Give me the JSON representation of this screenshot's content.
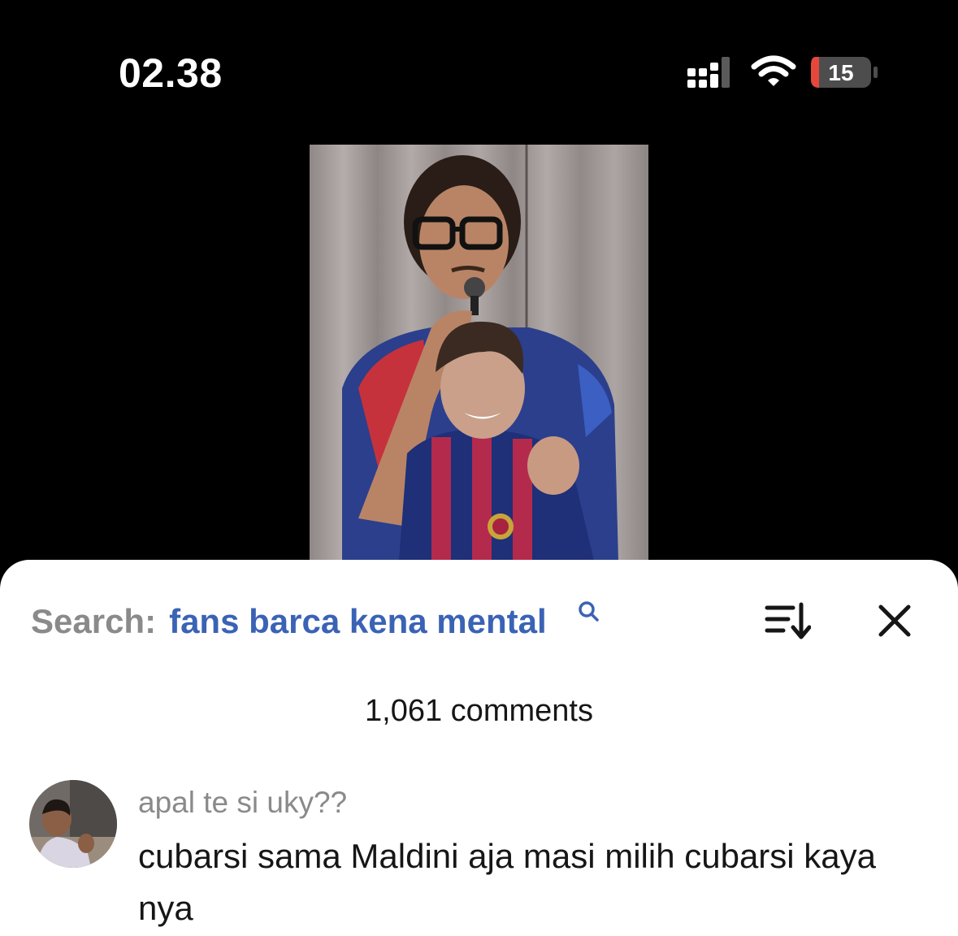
{
  "status_bar": {
    "time": "02.38",
    "battery_level": "15",
    "icons": [
      "signal-icon",
      "wifi-icon",
      "battery-icon"
    ]
  },
  "video": {
    "thumbnail": "video-thumbnail"
  },
  "comment_sheet": {
    "search_label": "Search:",
    "search_term": "fans barca kena mental",
    "icons": [
      "search-icon",
      "sort-icon",
      "close-icon"
    ],
    "comments_count": "1,061 comments",
    "comments": [
      {
        "username": "apal te si uky??",
        "text": "cubarsi sama Maldini aja masi milih cubarsi kaya nya"
      }
    ]
  },
  "colors": {
    "search_term": "#3a63b5",
    "muted_text": "#8a8a8a",
    "battery_low": "#e5483b"
  }
}
